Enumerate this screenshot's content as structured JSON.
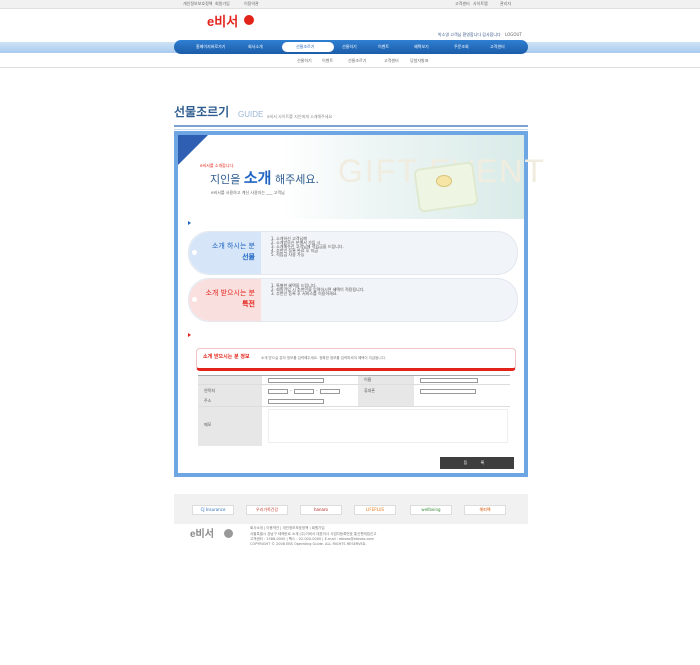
{
  "topbar": {
    "links": [
      "개인정보보호정책",
      "회원가입",
      "이용약관"
    ],
    "right_links": [
      "고객센터",
      "사이트맵",
      "관리자"
    ]
  },
  "header": {
    "logo_text": "e비서",
    "logo_badge": "중",
    "user_info": "박소영 고객님 환영합니다 감사합니다",
    "logout": "LOGOUT"
  },
  "nav": {
    "left_items": [
      "홈페이지바로가기",
      "회사소개"
    ],
    "items": [
      "선물조르기",
      "선물하기",
      "이벤트",
      "혜택보기",
      "주문조회",
      "고객센터"
    ],
    "sub_items": [
      "선물하기",
      "이벤트",
      "선물조르기",
      "고객센터",
      "당첨자발표"
    ]
  },
  "page": {
    "title": "선물조르기",
    "title_en": "GUIDE",
    "desc": "e비서 사이트를 지인에게 소개해주세요"
  },
  "banner": {
    "small": "e비서를 소개합니다.",
    "big_pre": "지인을 ",
    "big_em": "소개",
    "big_post": " 해주세요.",
    "sub": "e비서를 사용하고 계신 사용자는 ___ 고객님",
    "watermark": "GIFT EVENT"
  },
  "sections": [
    {
      "title_l1": "소개 하시는 분",
      "title_l2": "선물",
      "items": [
        "1. 소개하신 고객님께",
        "2. 소개받으신 분께서 가입 시",
        "3. 소개해주신 고객님께 적립금을 드립니다.",
        "4. 추천인 등록 완료 후 지급",
        "5. 적립금 사용 가능"
      ]
    },
    {
      "title_l1": "소개 받으시는 분",
      "title_l2": "특전",
      "items": [
        "1. 특별한 혜택을 드립니다.",
        "2. 회원가입 시 추천인을 입력하시면 혜택이 적용됩니다.",
        "3. 추천인 등록 후 서비스를 이용하세요."
      ]
    }
  ],
  "form": {
    "title": "소개 받으시는 분 정보",
    "note": "소개 받으실 분의 정보를 입력해주세요. 정확한 정보를 입력하셔야 혜택이 지급됩니다.",
    "fields": {
      "name_label": "",
      "email_label": "이름",
      "phone_label": "연락처",
      "mobile_label": "휴대폰",
      "address_label": "주소",
      "memo_label": "메모"
    },
    "phone_sep": "-",
    "submit": "등 록"
  },
  "footer": {
    "partners": [
      "CJ Insurance",
      "우리가족건강",
      "hanaro",
      "LIFEPLUS",
      "wellbeing",
      "해피팩"
    ],
    "logo": "e비서",
    "line1": "회사소개 | 이용약관 | 개인정보보호정책 | 회원가입",
    "line2": "서울특별시 강남구 테헤란로 소재 (주)이비서 대표이사 사업자등록번호 통신판매업신고",
    "line3": "고객센터 : 1588-0000 | 팩스 : 02-000-0000 | E-mail : ebiseo@ebiseo.com",
    "line4": "COPYRIGHT © 2008 EBS Operating Guide. ALL RIGHTS RESERVED."
  }
}
